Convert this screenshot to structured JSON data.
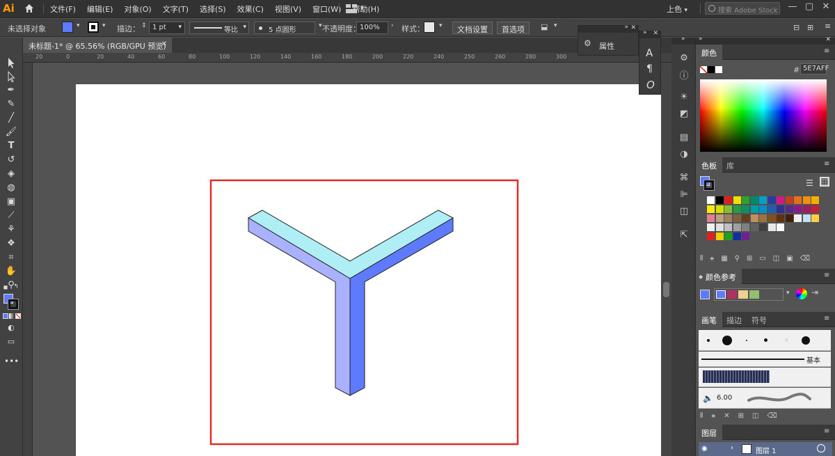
{
  "app": {
    "logo": "Ai"
  },
  "menu": [
    "文件(F)",
    "编辑(E)",
    "对象(O)",
    "文字(T)",
    "选择(S)",
    "效果(C)",
    "视图(V)",
    "窗口(W)",
    "帮助(H)"
  ],
  "workspace": {
    "label": "上色"
  },
  "search": {
    "placeholder": "搜索 Adobe Stock"
  },
  "control": {
    "selection": "未选择对象",
    "fill_color": "#5e7aff",
    "stroke_label": "描边：",
    "stroke_weight": "1 pt",
    "profile": "等比",
    "brush": "5 点圆形",
    "opacity_label": "不透明度：",
    "opacity_value": "100%",
    "style_label": "样式：",
    "doc_setup": "文档设置",
    "preferences": "首选项"
  },
  "document": {
    "tab": "未标题-1* @ 65.56% (RGB/GPU 预览)"
  },
  "ruler": {
    "top_ticks": [
      "20",
      "0",
      "20",
      "40",
      "60",
      "80",
      "100",
      "120",
      "140",
      "160",
      "180",
      "200",
      "220",
      "240",
      "250",
      "260",
      "280",
      "300"
    ]
  },
  "floating": {
    "properties": "属性"
  },
  "artwork": {
    "frame_color": "#e32a25",
    "top_face_color": "#b0eef6",
    "left_face_color": "#aab2ff",
    "right_face_color": "#5e7aff"
  },
  "color_panel": {
    "title": "颜色",
    "hex_label": "#",
    "hex_value": "5E7AFF"
  },
  "swatches_panel": {
    "tabs": [
      "色板",
      "库"
    ],
    "rows": [
      [
        "#ffffff",
        "#000000",
        "#e02020",
        "#f0e000",
        "#30a030",
        "#008a6a",
        "#00a0c8",
        "#2a3ca0",
        "#d01c80",
        "#c04020",
        "#e07020",
        "#f09010",
        "#f0b000"
      ],
      [
        "#f6ea10",
        "#d8e000",
        "#86c030",
        "#20a040",
        "#109060",
        "#00a0a0",
        "#0090d0",
        "#1f5fb0",
        "#303090",
        "#5a2a8a",
        "#8a1c8a",
        "#a01c60",
        "#c0203c"
      ],
      [
        "#e08090",
        "#c0a080",
        "#a08060",
        "#806040",
        "#604020",
        "#c09060",
        "#a07040",
        "#805020",
        "#603010",
        "#402000",
        "#f0f0f0",
        "#c0e0ff",
        "#ffd040"
      ],
      [
        "#f0f0f0",
        "#e0e0e0",
        "#c0c0c0",
        "#a0a0a0",
        "#808080",
        "#606060",
        "#404040",
        "#e8e8e8",
        "#f8f8f8"
      ],
      [
        "#e02020",
        "#f0d000",
        "#20a020",
        "#1030a0",
        "#702090"
      ]
    ]
  },
  "color_guide": {
    "title": "颜色参考",
    "swatches": [
      "#5e7aff",
      "#b03060",
      "#f0d090",
      "#90c070"
    ]
  },
  "brushes_panel": {
    "tabs": [
      "画笔",
      "描边",
      "符号"
    ],
    "basic_label": "基本",
    "size_value": "6.00"
  },
  "layers_panel": {
    "title": "图层",
    "layer_name": "图层 1"
  }
}
